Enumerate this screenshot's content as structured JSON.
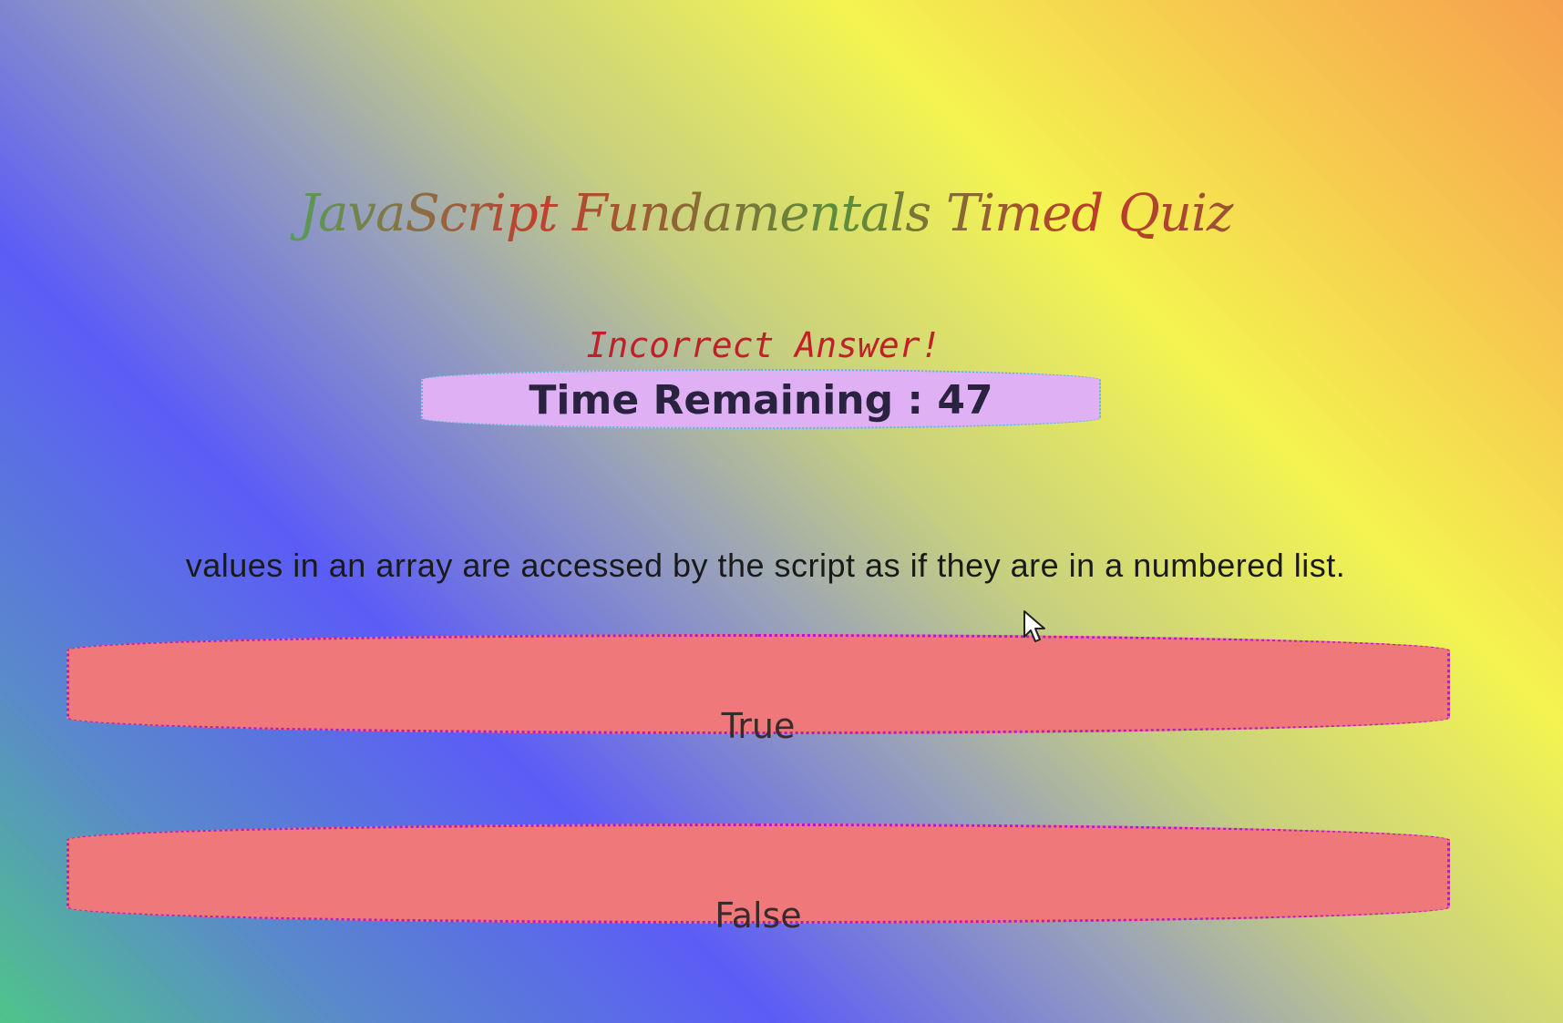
{
  "quiz": {
    "title": "JavaScript Fundamentals Timed Quiz",
    "feedback": "Incorrect Answer!",
    "timer": {
      "label": "Time Remaining : ",
      "value": "47"
    },
    "question": "values in an array are accessed by the script as if they are in a numbered list.",
    "answers": [
      {
        "label": "True"
      },
      {
        "label": "False"
      }
    ]
  },
  "colors": {
    "feedback": "#c0202a",
    "timer_background": "#e0b0f4",
    "answer_background": "#ef797a",
    "answer_border": "#b41cc0"
  },
  "icons": {
    "cursor": "mouse-pointer-icon"
  }
}
